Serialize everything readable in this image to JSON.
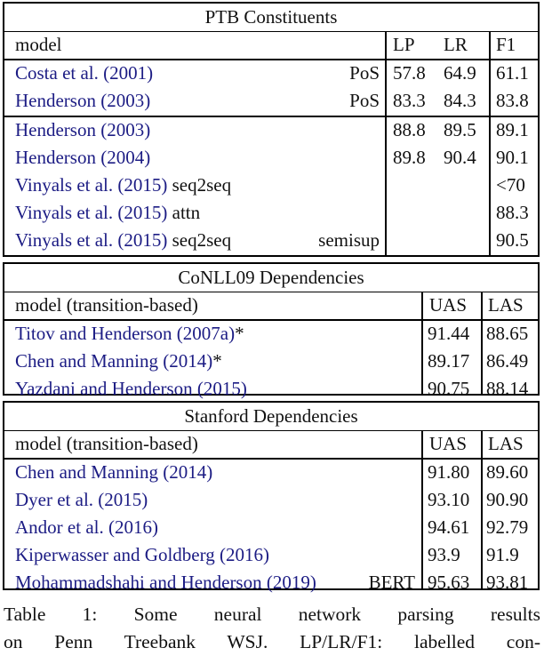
{
  "ptb": {
    "title": "PTB Constituents",
    "header": {
      "model": "model",
      "lp": "LP",
      "lr": "LR",
      "f1": "F1"
    },
    "group1": [
      {
        "cite": "Costa et al. (2001)",
        "extra": "",
        "tag": "PoS",
        "lp": "57.8",
        "lr": "64.9",
        "f1": "61.1"
      },
      {
        "cite": "Henderson (2003)",
        "extra": "",
        "tag": "PoS",
        "lp": "83.3",
        "lr": "84.3",
        "f1": "83.8"
      }
    ],
    "group2": [
      {
        "cite": "Henderson (2003)",
        "extra": "",
        "tag": "",
        "lp": "88.8",
        "lr": "89.5",
        "f1": "89.1"
      },
      {
        "cite": "Henderson (2004)",
        "extra": "",
        "tag": "",
        "lp": "89.8",
        "lr": "90.4",
        "f1": "90.1"
      },
      {
        "cite": "Vinyals et al. (2015)",
        "extra": " seq2seq",
        "tag": "",
        "lp": "",
        "lr": "",
        "f1": "<70"
      },
      {
        "cite": "Vinyals et al. (2015)",
        "extra": " attn",
        "tag": "",
        "lp": "",
        "lr": "",
        "f1": "88.3"
      },
      {
        "cite": "Vinyals et al. (2015)",
        "extra": " seq2seq",
        "tag": "semisup",
        "lp": "",
        "lr": "",
        "f1": "90.5"
      }
    ]
  },
  "conll": {
    "title": "CoNLL09 Dependencies",
    "header": {
      "model": "model (transition-based)",
      "uas": "UAS",
      "las": "LAS"
    },
    "rows": [
      {
        "cite": "Titov and Henderson (2007a)",
        "extra": "*",
        "tag": "",
        "uas": "91.44",
        "las": "88.65"
      },
      {
        "cite": "Chen and Manning (2014)",
        "extra": "*",
        "tag": "",
        "uas": "89.17",
        "las": "86.49"
      },
      {
        "cite": "Yazdani and Henderson (2015)",
        "extra": "",
        "tag": "",
        "uas": "90.75",
        "las": "88.14"
      }
    ]
  },
  "stanford": {
    "title": "Stanford Dependencies",
    "header": {
      "model": "model (transition-based)",
      "uas": "UAS",
      "las": "LAS"
    },
    "rows": [
      {
        "cite": "Chen and Manning (2014)",
        "extra": "",
        "tag": "",
        "uas": "91.80",
        "las": "89.60"
      },
      {
        "cite": "Dyer et al. (2015)",
        "extra": "",
        "tag": "",
        "uas": "93.10",
        "las": "90.90"
      },
      {
        "cite": "Andor et al. (2016)",
        "extra": "",
        "tag": "",
        "uas": "94.61",
        "las": "92.79"
      },
      {
        "cite": "Kiperwasser and Goldberg (2016)",
        "extra": "",
        "tag": "",
        "uas": "93.9",
        "las": "91.9"
      },
      {
        "cite": "Mohammadshahi and Henderson (2019)",
        "extra": "",
        "tag": "BERT",
        "uas": "95.63",
        "las": "93.81"
      }
    ]
  },
  "caption": {
    "line1": "Table 1:  Some neural network parsing results",
    "line2": "on Penn Treebank WSJ. LP/LR/F1: labelled con-"
  },
  "colors": {
    "citation": "#1c1c84",
    "rule": "#000000"
  }
}
